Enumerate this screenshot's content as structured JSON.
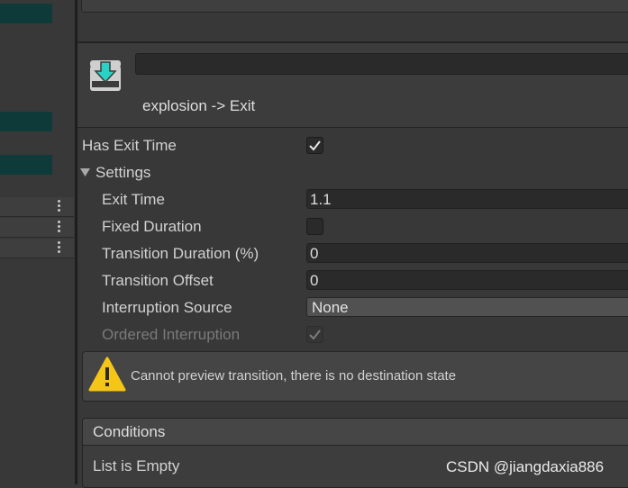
{
  "transition": {
    "title": "explosion -> Exit"
  },
  "has_exit_time": {
    "label": "Has Exit Time",
    "checked": true
  },
  "settings": {
    "label": "Settings",
    "exit_time": {
      "label": "Exit Time",
      "value": "1.1"
    },
    "fixed_duration": {
      "label": "Fixed Duration",
      "checked": false
    },
    "transition_duration": {
      "label": "Transition Duration (%)",
      "value": "0"
    },
    "transition_offset": {
      "label": "Transition Offset",
      "value": "0"
    },
    "interruption_source": {
      "label": "Interruption Source",
      "value": "None"
    },
    "ordered_interruption": {
      "label": "Ordered Interruption",
      "checked": true,
      "disabled": true
    }
  },
  "warning": {
    "text": "Cannot preview transition, there is no destination state",
    "icon": "warning-icon"
  },
  "conditions": {
    "title": "Conditions",
    "empty_text": "List is Empty"
  },
  "watermark": "CSDN @jiangdaxia886",
  "colors": {
    "background": "#383838",
    "accent_teal": "#0f3a3a",
    "warning_yellow": "#f5c518",
    "icon_teal": "#2bd1c4"
  }
}
